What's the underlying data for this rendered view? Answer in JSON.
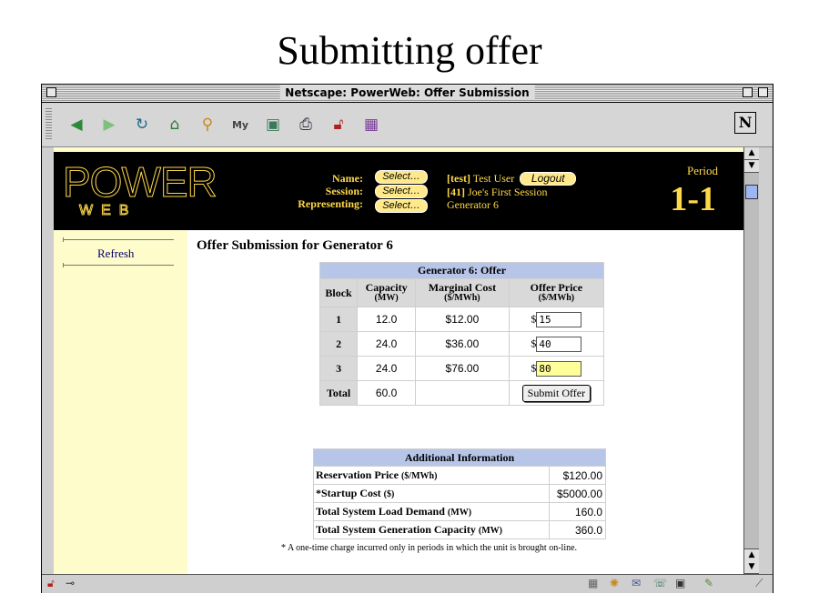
{
  "slide": {
    "title": "Submitting offer"
  },
  "window": {
    "title": "Netscape: PowerWeb: Offer Submission"
  },
  "toolbar": {
    "icons": [
      "back-icon",
      "forward-icon",
      "reload-icon",
      "home-icon",
      "search-icon",
      "my-netscape-icon",
      "images-icon",
      "print-icon",
      "security-icon",
      "shop-icon"
    ],
    "netscape_logo": "N"
  },
  "header": {
    "logo_top": "POWER",
    "logo_bottom": "WEB",
    "labels": {
      "name": "Name:",
      "session": "Session:",
      "representing": "Representing:"
    },
    "select_label": "Select…",
    "user_id": "[test]",
    "user_name": " Test User",
    "logout_label": "Logout",
    "session_id": "[41]",
    "session_name": " Joe's First Session",
    "representing_value": "Generator 6",
    "period_label": "Period",
    "period_value": "1-1"
  },
  "sidebar": {
    "refresh_label": "Refresh"
  },
  "main": {
    "title": "Offer Submission for Generator 6",
    "offer_table": {
      "caption": "Generator 6: Offer",
      "headers": {
        "block": "Block",
        "capacity": "Capacity",
        "capacity_unit": "(MW)",
        "marginal_cost": "Marginal Cost",
        "marginal_cost_unit": "($/MWh)",
        "offer_price": "Offer Price",
        "offer_price_unit": "($/MWh)"
      },
      "currency": "$",
      "rows": [
        {
          "block": "1",
          "capacity": "12.0",
          "marginal_cost": "$12.00",
          "offer_price": "15"
        },
        {
          "block": "2",
          "capacity": "24.0",
          "marginal_cost": "$36.00",
          "offer_price": "40"
        },
        {
          "block": "3",
          "capacity": "24.0",
          "marginal_cost": "$76.00",
          "offer_price": "80"
        }
      ],
      "total_label": "Total",
      "total_capacity": "60.0",
      "submit_label": "Submit Offer"
    },
    "additional_info": {
      "caption": "Additional Information",
      "rows": [
        {
          "label": "Reservation Price ",
          "unit": "($/MWh)",
          "value": "$120.00"
        },
        {
          "label": "*Startup Cost ",
          "unit": "($)",
          "value": "$5000.00"
        },
        {
          "label": "Total System Load Demand ",
          "unit": "(MW)",
          "value": "160.0"
        },
        {
          "label": "Total System Generation Capacity ",
          "unit": "(MW)",
          "value": "360.0"
        }
      ]
    },
    "footnote": "* A one-time charge incurred only in periods in which the unit is brought on-line."
  }
}
